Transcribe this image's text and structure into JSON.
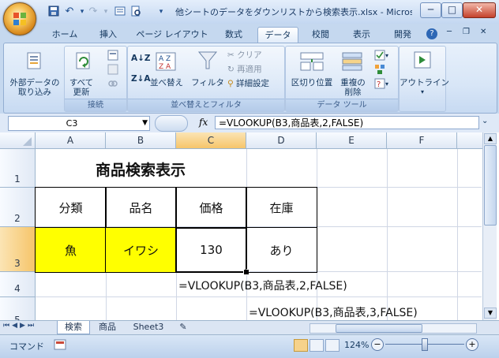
{
  "window": {
    "title": "他シートのデータをダウンリストから検索表示.xlsx - Micros...",
    "min_glyph": "─",
    "max_glyph": "□",
    "close_glyph": "✕"
  },
  "qat": {
    "save_icon": "save-icon",
    "undo_icon": "undo-icon",
    "redo_icon": "redo-icon"
  },
  "tabs": {
    "help_glyph": "?",
    "items": [
      {
        "label": "ホーム"
      },
      {
        "label": "挿入"
      },
      {
        "label": "ページ レイアウト"
      },
      {
        "label": "数式"
      },
      {
        "label": "データ"
      },
      {
        "label": "校閲"
      },
      {
        "label": "表示"
      },
      {
        "label": "開発"
      }
    ],
    "active": "データ"
  },
  "ribbon": {
    "external": {
      "label1": "外部データの",
      "label2": "取り込み"
    },
    "connect_group": {
      "refresh1": "すべて",
      "refresh2": "更新",
      "label": "接続"
    },
    "sort_group": {
      "sort": "並べ替え",
      "filter": "フィルタ",
      "clear": "クリア",
      "reapply": "再適用",
      "advanced": "詳細設定",
      "label": "並べ替えとフィルタ"
    },
    "tools_group": {
      "text_to_columns": "区切り位置",
      "remove_dup1": "重複の",
      "remove_dup2": "削除",
      "label": "データ ツール"
    },
    "outline": {
      "label": "アウトライン"
    }
  },
  "formula_bar": {
    "name_box": "C3",
    "fx": "fx",
    "formula": "=VLOOKUP(B3,商品表,2,FALSE)"
  },
  "sheet": {
    "columns": [
      "A",
      "B",
      "C",
      "D",
      "E",
      "F"
    ],
    "rows": [
      "1",
      "2",
      "3",
      "4",
      "5"
    ],
    "title": "商品検索表示",
    "headers": [
      "分類",
      "品名",
      "価格",
      "在庫"
    ],
    "values": [
      "魚",
      "イワシ",
      "130",
      "あり"
    ],
    "note_row4": "=VLOOKUP(B3,商品表,2,FALSE)",
    "note_row5": "=VLOOKUP(B3,商品表,3,FALSE)"
  },
  "sheet_tabs": [
    "検索",
    "商品",
    "Sheet3"
  ],
  "status": {
    "mode": "コマンド",
    "zoom": "124%"
  },
  "colors": {
    "highlight": "#ffff00",
    "selected_header": "#f6c56a",
    "ribbon_bg": "#d8e6f7"
  }
}
